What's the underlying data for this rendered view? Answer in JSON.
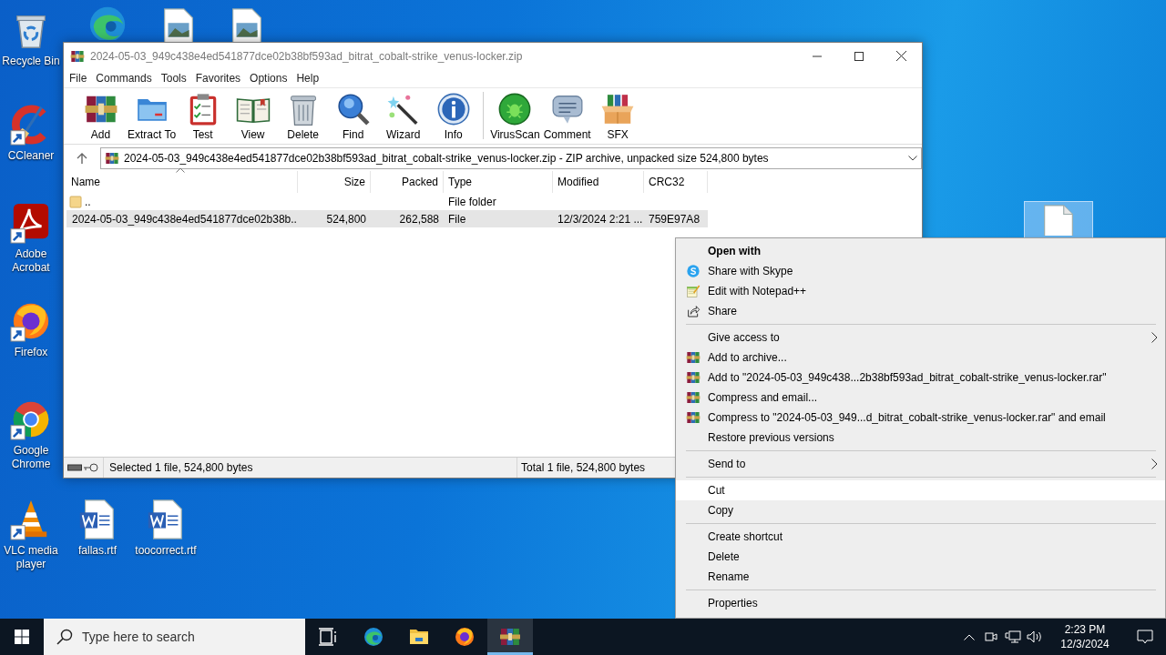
{
  "desktop": {
    "icons": [
      {
        "kind": "recycle",
        "label": "Recycle Bin",
        "selected": false
      },
      {
        "kind": "edge",
        "selected": false
      },
      {
        "kind": "image-file",
        "selected": false
      },
      {
        "kind": "image-file",
        "selected": false
      },
      {
        "kind": "ccleaner",
        "label": "CCleaner",
        "selected": false
      },
      {
        "kind": "acrobat",
        "label": "Adobe Acrobat",
        "selected": false
      },
      {
        "kind": "firefox",
        "label": "Firefox",
        "selected": false
      },
      {
        "kind": "chrome",
        "label": "Google Chrome",
        "selected": false
      },
      {
        "kind": "vlc",
        "label": "VLC media player",
        "selected": false
      },
      {
        "kind": "word-file",
        "label": "fallas.rtf",
        "selected": false
      },
      {
        "kind": "word-file",
        "label": "toocorrect.rtf",
        "selected": false
      },
      {
        "kind": "blank-file",
        "selected": true
      }
    ]
  },
  "window": {
    "title": "2024-05-03_949c438e4ed541877dce02b38bf593ad_bitrat_cobalt-strike_venus-locker.zip",
    "menu": [
      "File",
      "Commands",
      "Tools",
      "Favorites",
      "Options",
      "Help"
    ],
    "toolbar": [
      {
        "kind": "add",
        "label": "Add"
      },
      {
        "kind": "extract",
        "label": "Extract To"
      },
      {
        "kind": "test",
        "label": "Test"
      },
      {
        "kind": "view",
        "label": "View"
      },
      {
        "kind": "delete",
        "label": "Delete"
      },
      {
        "kind": "find",
        "label": "Find"
      },
      {
        "kind": "wizard",
        "label": "Wizard"
      },
      {
        "kind": "info",
        "label": "Info"
      },
      {
        "kind": "separator"
      },
      {
        "kind": "virusscan",
        "label": "VirusScan"
      },
      {
        "kind": "comment",
        "label": "Comment"
      },
      {
        "kind": "sfx",
        "label": "SFX"
      }
    ],
    "address": "2024-05-03_949c438e4ed541877dce02b38bf593ad_bitrat_cobalt-strike_venus-locker.zip - ZIP archive, unpacked size 524,800 bytes",
    "columns": [
      {
        "label": "Name",
        "sorted": true
      },
      {
        "label": "Size",
        "sorted": false
      },
      {
        "label": "Packed",
        "sorted": false
      },
      {
        "label": "Type",
        "sorted": false
      },
      {
        "label": "Modified",
        "sorted": false
      },
      {
        "label": "CRC32",
        "sorted": false
      }
    ],
    "rows": [
      {
        "kind": "folder",
        "name": "..",
        "type": "File folder",
        "selected": false
      },
      {
        "kind": "file",
        "name": "2024-05-03_949c438e4ed541877dce02b38b...",
        "size": "524,800",
        "packed": "262,588",
        "type": "File",
        "modified": "12/3/2024 2:21 ...",
        "crc32": "759E97A8",
        "selected": true
      }
    ],
    "status": {
      "selection": "Selected 1 file, 524,800 bytes",
      "total": "Total 1 file, 524,800 bytes"
    }
  },
  "context_menu": {
    "items": [
      {
        "kind": "item",
        "label": "Open with",
        "default": true,
        "submenu": false,
        "selected": false
      },
      {
        "kind": "item",
        "label": "Share with Skype",
        "default": false,
        "submenu": false,
        "selected": false
      },
      {
        "kind": "item",
        "label": "Edit with Notepad++",
        "default": false,
        "submenu": false,
        "selected": false
      },
      {
        "kind": "item",
        "label": "Share",
        "default": false,
        "submenu": false,
        "selected": false
      },
      {
        "kind": "separator"
      },
      {
        "kind": "item",
        "label": "Give access to",
        "default": false,
        "submenu": true,
        "selected": false
      },
      {
        "kind": "item",
        "label": "Add to archive...",
        "default": false,
        "submenu": false,
        "selected": false
      },
      {
        "kind": "item",
        "label": "Add to \"2024-05-03_949c438...2b38bf593ad_bitrat_cobalt-strike_venus-locker.rar\"",
        "default": false,
        "submenu": false,
        "selected": false
      },
      {
        "kind": "item",
        "label": "Compress and email...",
        "default": false,
        "submenu": false,
        "selected": false
      },
      {
        "kind": "item",
        "label": "Compress to \"2024-05-03_949...d_bitrat_cobalt-strike_venus-locker.rar\" and email",
        "default": false,
        "submenu": false,
        "selected": false
      },
      {
        "kind": "item",
        "label": "Restore previous versions",
        "default": false,
        "submenu": false,
        "selected": false
      },
      {
        "kind": "separator"
      },
      {
        "kind": "item",
        "label": "Send to",
        "default": false,
        "submenu": true,
        "selected": false
      },
      {
        "kind": "separator"
      },
      {
        "kind": "item",
        "label": "Cut",
        "default": false,
        "submenu": false,
        "selected": true
      },
      {
        "kind": "item",
        "label": "Copy",
        "default": false,
        "submenu": false,
        "selected": false
      },
      {
        "kind": "separator"
      },
      {
        "kind": "item",
        "label": "Create shortcut",
        "default": false,
        "submenu": false,
        "selected": false
      },
      {
        "kind": "item",
        "label": "Delete",
        "default": false,
        "submenu": false,
        "selected": false
      },
      {
        "kind": "item",
        "label": "Rename",
        "default": false,
        "submenu": false,
        "selected": false
      },
      {
        "kind": "separator"
      },
      {
        "kind": "item",
        "label": "Properties",
        "default": false,
        "submenu": false,
        "selected": false
      }
    ]
  },
  "taskbar": {
    "search_placeholder": "Type here to search",
    "apps": [
      {
        "kind": "taskview",
        "active": false
      },
      {
        "kind": "edge",
        "active": false
      },
      {
        "kind": "explorer",
        "active": false
      },
      {
        "kind": "firefox",
        "active": false
      },
      {
        "kind": "winrar",
        "active": true
      }
    ],
    "time": "2:23 PM",
    "date": "12/3/2024"
  }
}
